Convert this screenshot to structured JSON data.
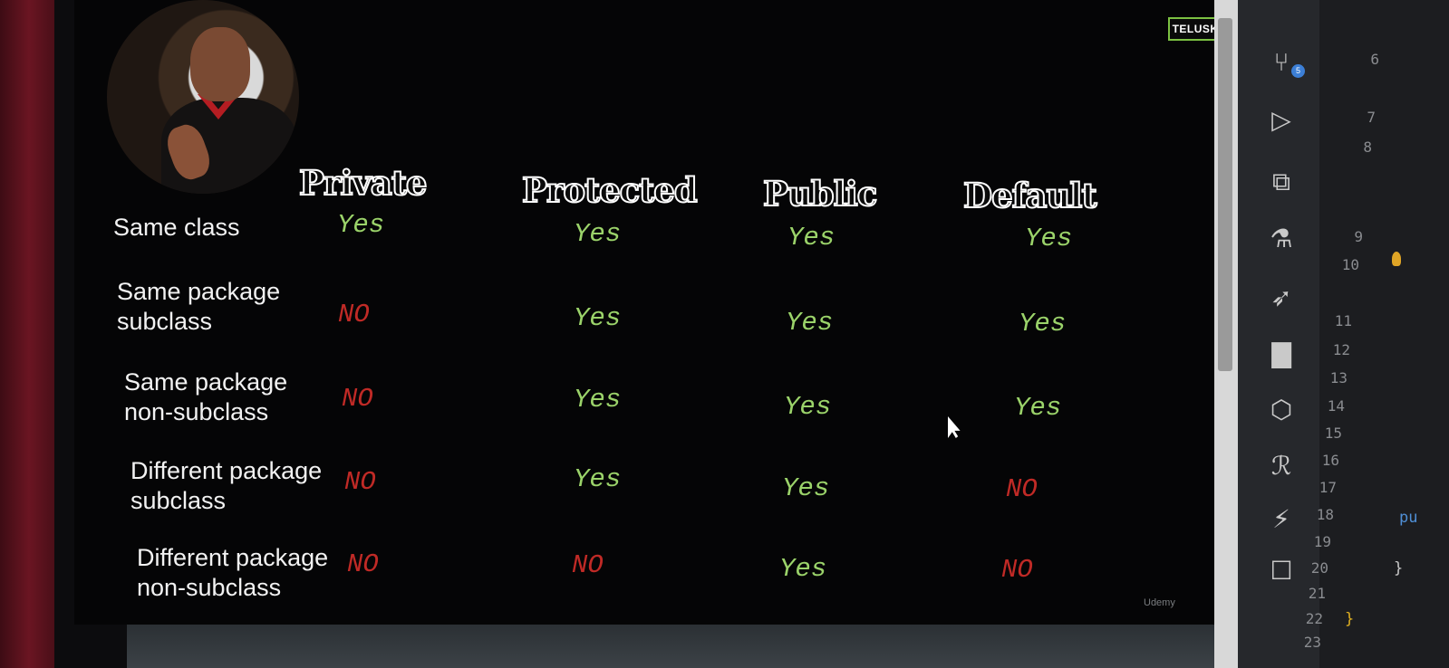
{
  "logo": "TELUSKO",
  "columns": [
    "Private",
    "Protected",
    "Public",
    "Default"
  ],
  "rows": [
    {
      "label": [
        "Same class"
      ],
      "values": [
        "Yes",
        "Yes",
        "Yes",
        "Yes"
      ]
    },
    {
      "label": [
        "Same package",
        "subclass"
      ],
      "values": [
        "NO",
        "Yes",
        "Yes",
        "Yes"
      ]
    },
    {
      "label": [
        "Same package",
        "non-subclass"
      ],
      "values": [
        "NO",
        "Yes",
        "Yes",
        "Yes"
      ]
    },
    {
      "label": [
        "Different package",
        "subclass"
      ],
      "values": [
        "NO",
        "Yes",
        "Yes",
        "NO"
      ]
    },
    {
      "label": [
        "Different package",
        "non-subclass"
      ],
      "values": [
        "NO",
        "NO",
        "Yes",
        "NO"
      ]
    }
  ],
  "watermark": "Udemy",
  "source_control_badge": "5",
  "line_numbers": [
    "6",
    "7",
    "8",
    "9",
    "10",
    "11",
    "12",
    "13",
    "14",
    "15",
    "16",
    "17",
    "18",
    "19",
    "20",
    "21",
    "22",
    "23"
  ],
  "code_fragments": {
    "line18": "pu",
    "line20": "}",
    "line22": "}"
  },
  "activity_icons": [
    "source-control-icon",
    "run-debug-icon",
    "extensions-icon",
    "testing-icon",
    "remote-icon",
    "chart-icon",
    "docker-icon",
    "r-language-icon",
    "lightning-icon",
    "remote-explorer-icon"
  ],
  "colors": {
    "yes": "#9bd36a",
    "no": "#c02a26",
    "logo_border": "#7cc142"
  }
}
